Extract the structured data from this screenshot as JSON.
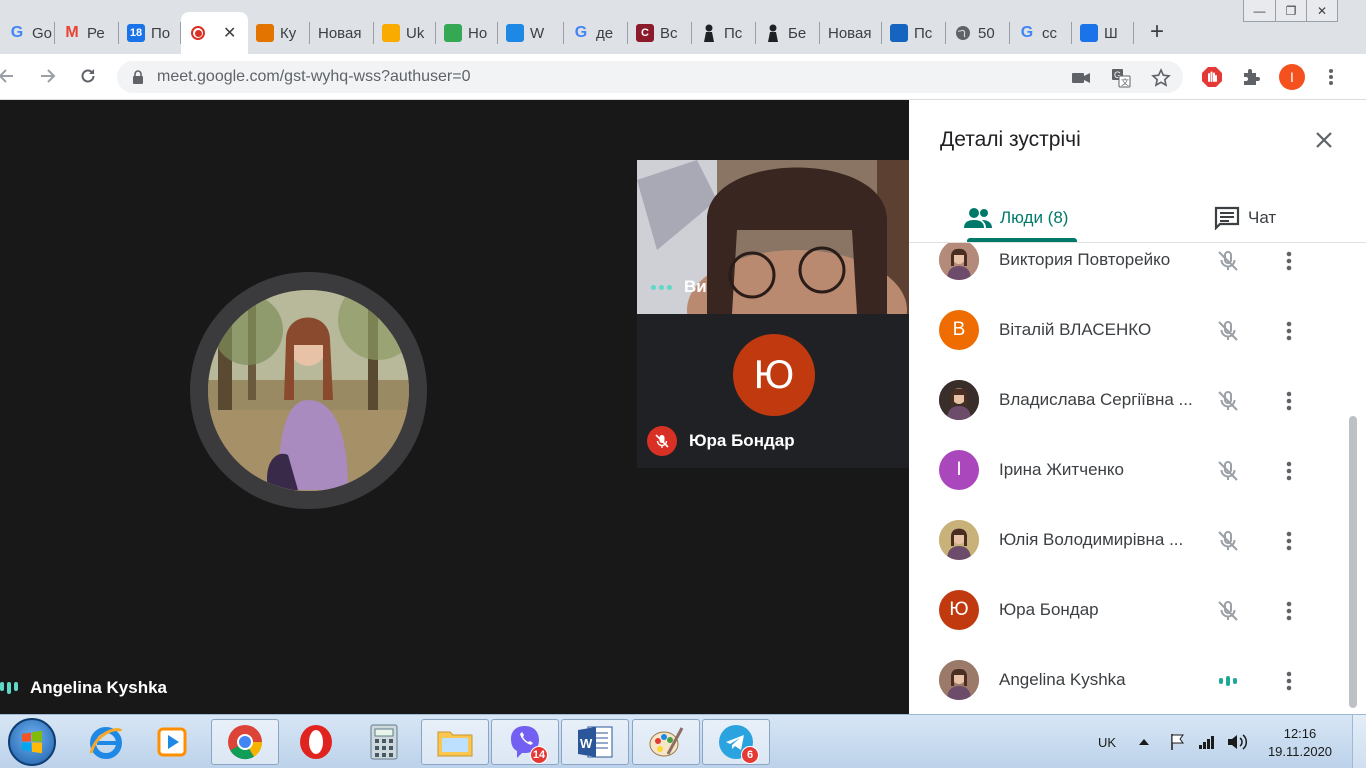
{
  "browser": {
    "tabs": [
      {
        "title": "Go",
        "favicon": "google-icon",
        "color": "#4285f4"
      },
      {
        "title": "Ре",
        "favicon": "gmail-icon",
        "color": "#ea4335"
      },
      {
        "title": "По",
        "favicon": "calendar-icon",
        "color": "#1a73e8",
        "fav_text": "18"
      },
      {
        "title": "",
        "favicon": "recording-icon",
        "color": "#d93025",
        "active": true
      },
      {
        "title": "Ку",
        "favicon": "site-icon",
        "color": "#e37400"
      },
      {
        "title": "Новая",
        "favicon": "",
        "color": ""
      },
      {
        "title": "Uk",
        "favicon": "site-icon",
        "color": "#f9ab00"
      },
      {
        "title": "Но",
        "favicon": "mail-icon",
        "color": "#34a853"
      },
      {
        "title": "W",
        "favicon": "site-icon",
        "color": "#1e88e5"
      },
      {
        "title": "де",
        "favicon": "google-icon",
        "color": "#4285f4"
      },
      {
        "title": "Вс",
        "favicon": "site-icon",
        "color": "#8b1a2b",
        "fav_text": "C"
      },
      {
        "title": "Пс",
        "favicon": "silhouette-icon",
        "color": "#202124"
      },
      {
        "title": "Бе",
        "favicon": "silhouette-icon",
        "color": "#202124"
      },
      {
        "title": "Новая",
        "favicon": "",
        "color": ""
      },
      {
        "title": "Пс",
        "favicon": "site-icon",
        "color": "#1565c0"
      },
      {
        "title": "50",
        "favicon": "globe-icon",
        "color": "#5f6368"
      },
      {
        "title": "сс",
        "favicon": "google-icon",
        "color": "#4285f4"
      },
      {
        "title": "Ш",
        "favicon": "move-icon",
        "color": "#1a73e8"
      }
    ],
    "new_tab_label": "+",
    "url": "meet.google.com/gst-wyhq-wss?authuser=0",
    "profile_initial": "I"
  },
  "meet": {
    "main_tile_name": "Angelina Kyshka",
    "tile1_name": "Ви",
    "tile2_name": "Юра Бондар",
    "tile2_initial": "Ю"
  },
  "panel": {
    "title": "Деталі зустрічі",
    "tab_people": "Люди (8)",
    "tab_chat": "Чат",
    "participants": [
      {
        "name": "Виктория Повторейко",
        "initial": "",
        "avatar_color": "#b48a7a",
        "muted": true
      },
      {
        "name": "Віталій ВЛАСЕНКО",
        "initial": "В",
        "avatar_color": "#ef6c00",
        "muted": true
      },
      {
        "name": "Владислава Сергіївна ...",
        "initial": "",
        "avatar_color": "#3a2e2a",
        "muted": true
      },
      {
        "name": "Ірина Житченко",
        "initial": "I",
        "avatar_color": "#ab47bc",
        "muted": true
      },
      {
        "name": "Юлія Володимирівна ...",
        "initial": "",
        "avatar_color": "#c9b27a",
        "muted": true
      },
      {
        "name": "Юра Бондар",
        "initial": "Ю",
        "avatar_color": "#c0390f",
        "muted": true
      },
      {
        "name": "Angelina Kyshka",
        "initial": "",
        "avatar_color": "#9c7a6a",
        "muted": false
      }
    ]
  },
  "taskbar": {
    "viber_badge": "14",
    "telegram_badge": "6",
    "language": "UK",
    "time": "12:16",
    "date": "19.11.2020"
  }
}
